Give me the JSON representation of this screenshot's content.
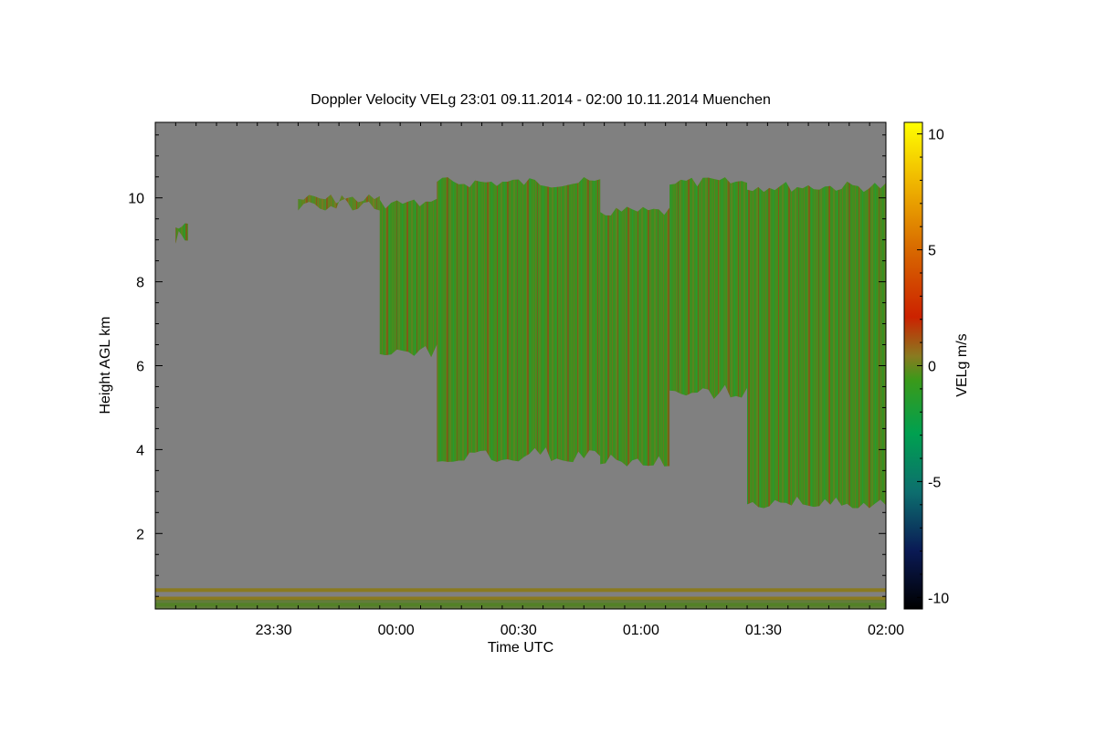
{
  "chart_data": {
    "type": "heatmap",
    "title": "Doppler Velocity VELg   23:01 09.11.2014 - 02:00 10.11.2014 Muenchen",
    "xlabel": "Time UTC",
    "ylabel": "Height AGL km",
    "colorbar_label": "VELg m/s",
    "x_range": [
      "23:01",
      "02:00"
    ],
    "x_ticks": [
      "23:30",
      "00:00",
      "00:30",
      "01:00",
      "01:30",
      "02:00"
    ],
    "ylim": [
      0.2,
      11.8
    ],
    "y_ticks": [
      2,
      4,
      6,
      8,
      10
    ],
    "y_tick_labels": [
      "2",
      "4",
      "6",
      "8",
      "10"
    ],
    "colorbar_range": [
      -10.5,
      10.5
    ],
    "colorbar_ticks": [
      10,
      5,
      0,
      -5,
      -10
    ],
    "colorbar_tick_labels": [
      "10",
      "5",
      "0",
      "-5",
      "-10"
    ],
    "background_color": "#808080",
    "colormap": [
      "#000000",
      "#0a1a55",
      "#0d6e6e",
      "#00a050",
      "#3a9a1a",
      "#8a7a20",
      "#cc2200",
      "#d86a00",
      "#f0b800",
      "#ffff00"
    ],
    "echo_regions": [
      {
        "time_start": "23:36",
        "time_end": "23:56",
        "height_bottom": 9.7,
        "height_top": 10.1,
        "dominant_velocity": 0
      },
      {
        "time_start": "23:56",
        "time_end": "00:10",
        "height_bottom": 6.2,
        "height_top": 10.0,
        "dominant_velocity": -0.5
      },
      {
        "time_start": "00:10",
        "time_end": "00:50",
        "height_bottom": 3.7,
        "height_top": 10.5,
        "dominant_velocity": -1
      },
      {
        "time_start": "00:50",
        "time_end": "01:07",
        "height_bottom": 3.6,
        "height_top": 9.8,
        "dominant_velocity": -1
      },
      {
        "time_start": "01:07",
        "time_end": "01:26",
        "height_bottom": 5.2,
        "height_top": 10.5,
        "dominant_velocity": -0.5
      },
      {
        "time_start": "01:26",
        "time_end": "02:00",
        "height_bottom": 2.6,
        "height_top": 10.4,
        "dominant_velocity": -1
      },
      {
        "time_start": "23:06",
        "time_end": "23:09",
        "height_bottom": 8.9,
        "height_top": 9.4,
        "dominant_velocity": -1
      }
    ],
    "near_ground_layers": [
      {
        "height": 0.65,
        "velocity": 1.5
      },
      {
        "height": 0.45,
        "velocity": 0
      },
      {
        "height": 0.3,
        "velocity": -0.5
      }
    ]
  }
}
